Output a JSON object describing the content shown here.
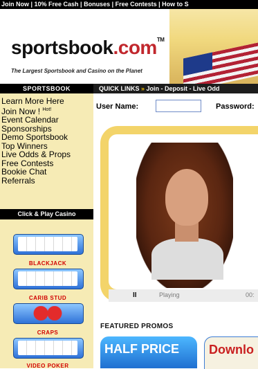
{
  "topbar": {
    "text": "Join Now | 10% Free Cash | Bonuses | Free Contests | How to S"
  },
  "header": {
    "logo_main": "sportsbook",
    "logo_dot": ".com",
    "logo_tm": "TM",
    "tagline": "The Largest Sportsbook and Casino on the Planet"
  },
  "sidebar": {
    "title": "SPORTSBOOK",
    "items": [
      "Learn More Here",
      "Join Now !",
      "Event Calendar",
      "Sponsorships",
      "Demo Sportsbook",
      "Top Winners",
      "Live Odds & Props",
      "Free Contests",
      "Bookie Chat",
      "Referrals"
    ],
    "hot_badge": "Hot!",
    "casino_title": "Click & Play Casino",
    "games": [
      {
        "label": "BLACKJACK",
        "icon": "cards-icon"
      },
      {
        "label": "CARIB STUD",
        "icon": "cards-icon"
      },
      {
        "label": "CRAPS",
        "icon": "dice-icon"
      },
      {
        "label": "VIDEO POKER",
        "icon": "cards-icon"
      }
    ]
  },
  "quicklinks": {
    "title": "QUICK LINKS",
    "arrow": "»",
    "links": "Join - Deposit - Live Odd"
  },
  "login": {
    "user_label": "User Name:",
    "password_label": "Password:"
  },
  "video": {
    "pause_symbol": "II",
    "status": "Playing",
    "time": "00:"
  },
  "promos": {
    "title": "FEATURED PROMOS",
    "promo1": "HALF PRICE",
    "promo2": "Downlo"
  },
  "colors": {
    "gold": "#f3d46a",
    "sidebar_bg": "#f6ebb5",
    "black": "#000000",
    "red": "#c1272d"
  }
}
